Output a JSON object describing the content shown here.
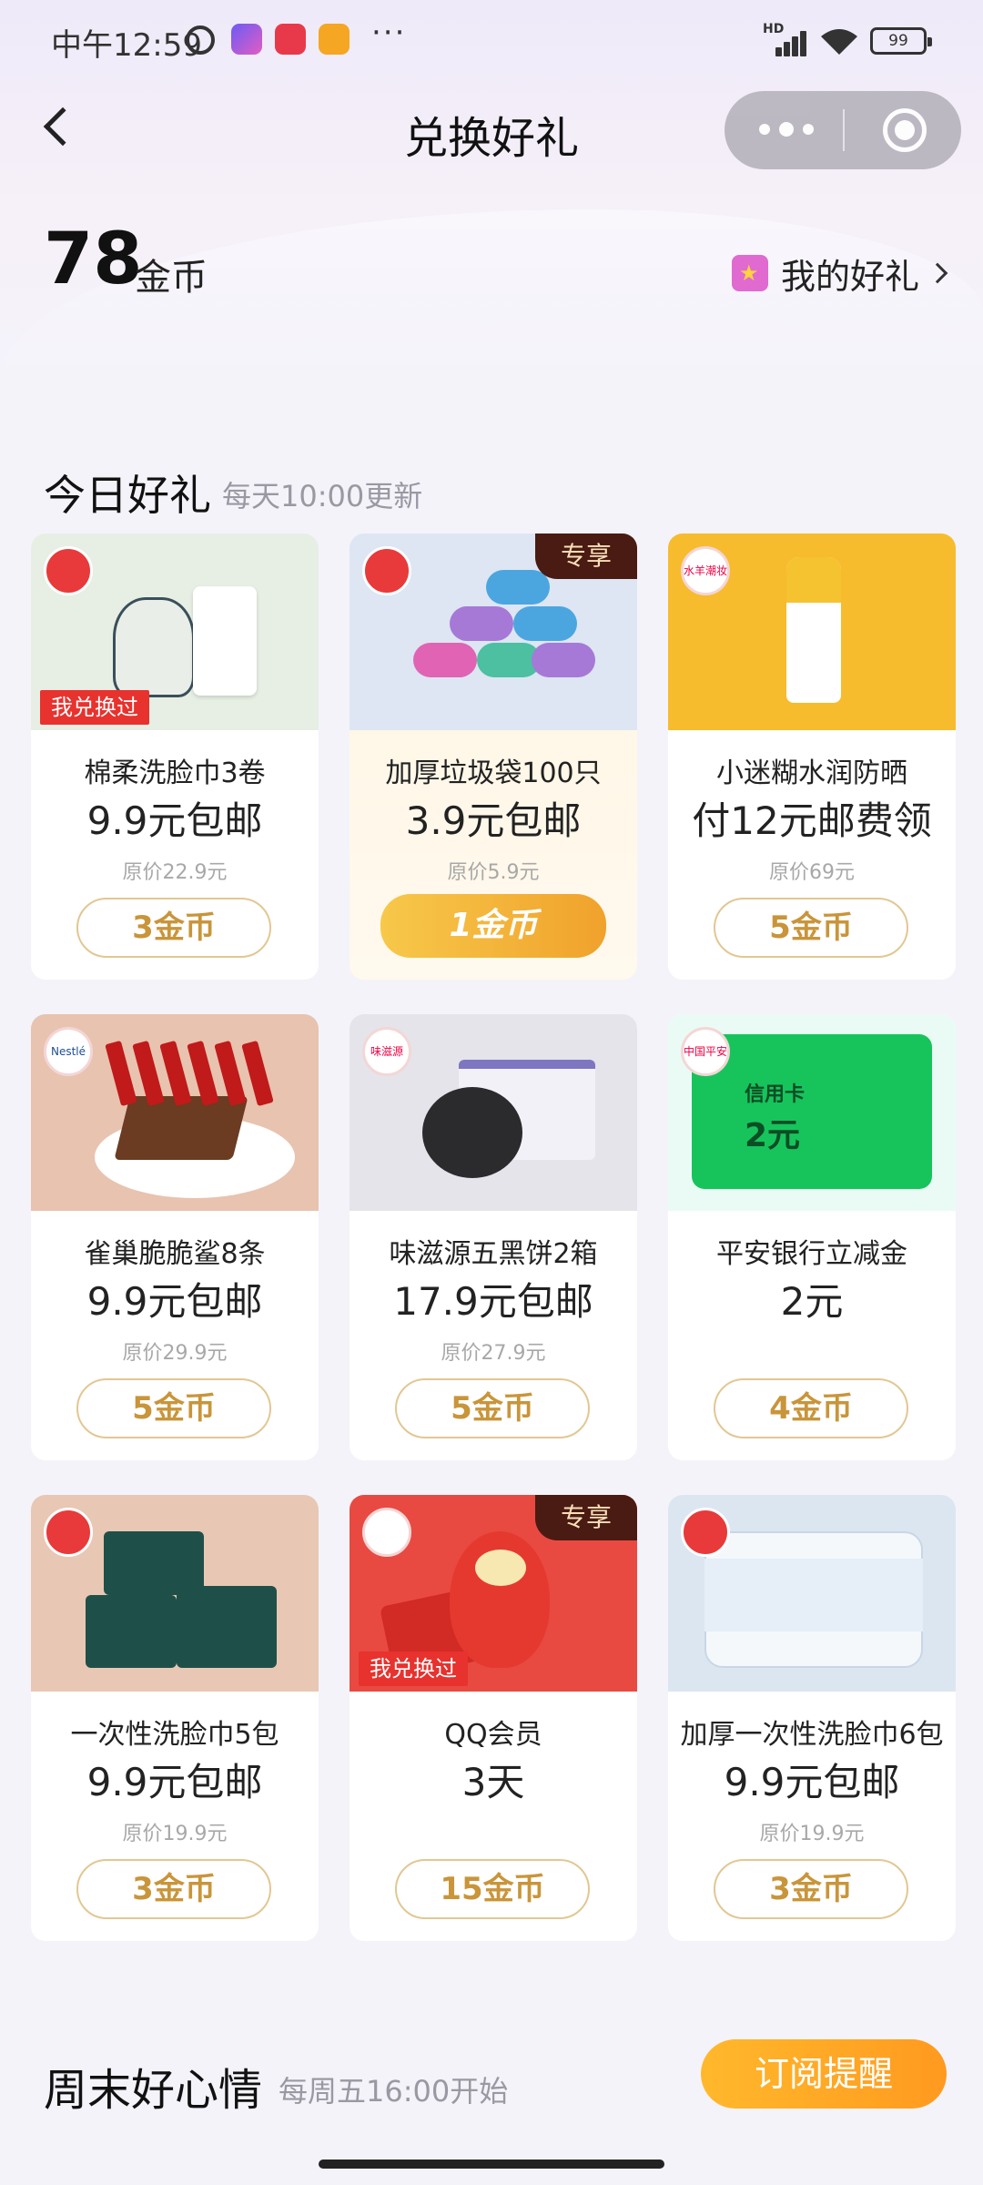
{
  "status_bar": {
    "time": "中午12:59",
    "more": "···",
    "hd": "HD",
    "battery": "99"
  },
  "header": {
    "title": "兑换好礼"
  },
  "coins": {
    "amount": "78",
    "unit": "金币",
    "my_gifts_label": "我的好礼"
  },
  "today": {
    "title": "今日好礼",
    "subtitle": "每天10:00更新"
  },
  "products": [
    {
      "name": "棉柔洗脸巾3卷",
      "price": "9.9元包邮",
      "original": "原价22.9元",
      "cost": "3金币",
      "tag": "我兑换过",
      "exclusive": "",
      "badge": "jd"
    },
    {
      "name": "加厚垃圾袋100只",
      "price": "3.9元包邮",
      "original": "原价5.9元",
      "cost": "1金币",
      "tag": "",
      "exclusive": "专享",
      "badge": "jd"
    },
    {
      "name": "小迷糊水润防晒",
      "price": "付12元邮费领",
      "original": "原价69元",
      "cost": "5金币",
      "tag": "",
      "exclusive": "",
      "badge": "brand",
      "badge_text": "水羊潮妆"
    },
    {
      "name": "雀巢脆脆鲨8条",
      "price": "9.9元包邮",
      "original": "原价29.9元",
      "cost": "5金币",
      "tag": "",
      "exclusive": "",
      "badge": "brand",
      "badge_text": "Nestlé"
    },
    {
      "name": "味滋源五黑饼2箱",
      "price": "17.9元包邮",
      "original": "原价27.9元",
      "cost": "5金币",
      "tag": "",
      "exclusive": "",
      "badge": "brand",
      "badge_text": "味滋源"
    },
    {
      "name": "平安银行立减金",
      "price": "2元",
      "original": "",
      "cost": "4金币",
      "tag": "",
      "exclusive": "",
      "badge": "brand",
      "badge_text": "中国平安",
      "card_label": "信用卡",
      "card_value": "2元"
    },
    {
      "name": "一次性洗脸巾5包",
      "price": "9.9元包邮",
      "original": "原价19.9元",
      "cost": "3金币",
      "tag": "",
      "exclusive": "",
      "badge": "jd"
    },
    {
      "name": "QQ会员",
      "price": "3天",
      "original": "",
      "cost": "15金币",
      "tag": "我兑换过",
      "exclusive": "专享",
      "badge": "qq"
    },
    {
      "name": "加厚一次性洗脸巾6包",
      "price": "9.9元包邮",
      "original": "原价19.9元",
      "cost": "3金币",
      "tag": "",
      "exclusive": "",
      "badge": "jd"
    }
  ],
  "weekend": {
    "title": "周末好心情",
    "subtitle": "每周五16:00开始",
    "subscribe_label": "订阅提醒"
  },
  "colors": {
    "accent_gold": "#c9953a",
    "tag_red": "#e8322e",
    "subscribe_orange": "#ff9a1f"
  }
}
